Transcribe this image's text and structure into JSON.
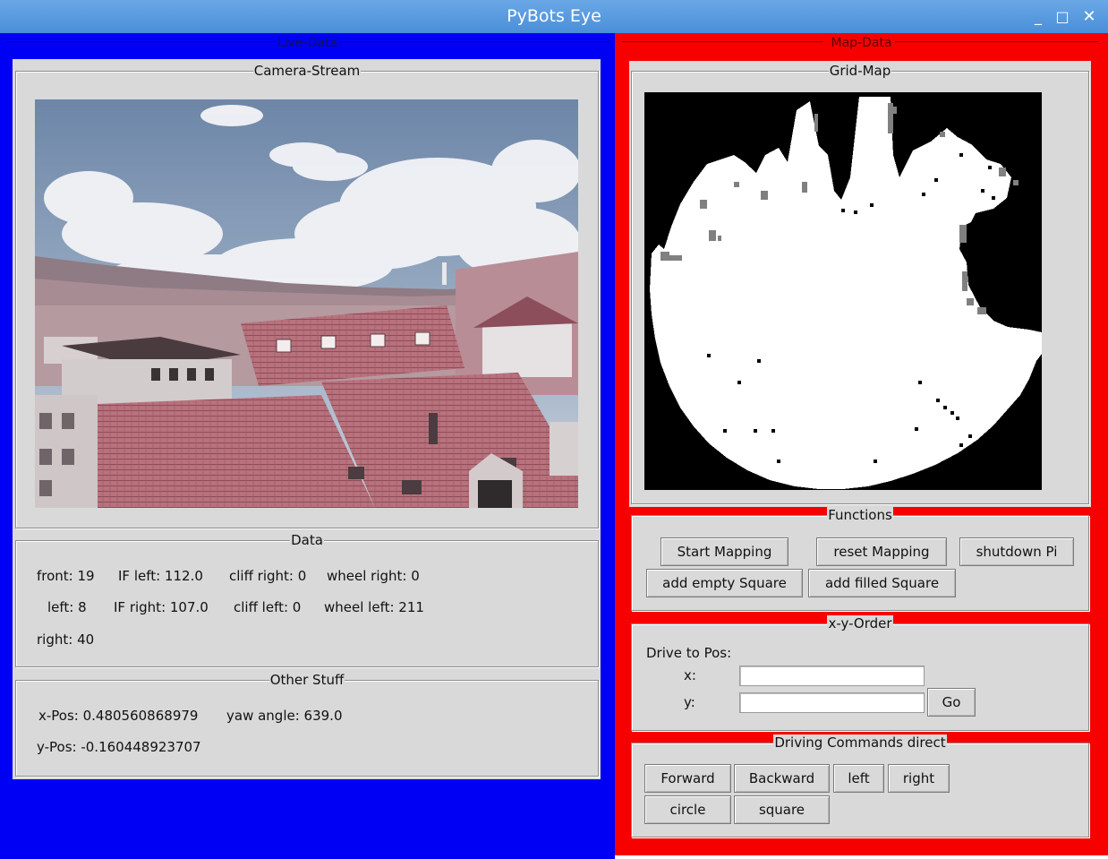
{
  "window": {
    "title": "PyBots Eye",
    "controls": {
      "minimize": "_",
      "maximize": "□",
      "close": "✕"
    }
  },
  "colors": {
    "live_panel": "#0000f5",
    "map_panel": "#f70000",
    "titlebar": "#5a9be0",
    "frame_bg": "#d9d9d9"
  },
  "live_data": {
    "title": "Live-Data",
    "camera_stream": {
      "title": "Camera-Stream"
    },
    "data": {
      "title": "Data",
      "front": "front: 19",
      "ir_left": "IF left: 112.0",
      "cliff_right": "cliff right: 0",
      "wheel_right": "wheel right: 0",
      "left": "left: 8",
      "ir_right": "IF right: 107.0",
      "cliff_left": "cliff left: 0",
      "wheel_left": "wheel left: 211",
      "right": "right: 40"
    },
    "other_stuff": {
      "title": "Other Stuff",
      "x_pos": "x-Pos: 0.480560868979",
      "yaw_angle": "yaw angle: 639.0",
      "y_pos": "y-Pos: -0.160448923707"
    }
  },
  "map_data": {
    "title": "Map-Data",
    "grid_map": {
      "title": "Grid-Map"
    },
    "functions": {
      "title": "Functions",
      "start_mapping": "Start Mapping",
      "reset_mapping": "reset Mapping",
      "shutdown_pi": "shutdown Pi",
      "add_empty_square": "add empty Square",
      "add_filled_square": "add filled Square"
    },
    "xy_order": {
      "title": "x-y-Order",
      "drive_to_pos": "Drive to Pos:",
      "x_label": "x:",
      "y_label": "y:",
      "x_value": "",
      "y_value": "",
      "go": "Go"
    },
    "driving_commands": {
      "title": "Driving Commands direct",
      "forward": "Forward",
      "backward": "Backward",
      "left": "left",
      "right": "right",
      "circle": "circle",
      "square": "square"
    }
  }
}
